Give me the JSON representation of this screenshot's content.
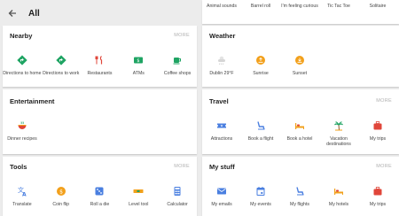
{
  "header": {
    "title": "All",
    "back_icon": "arrow-left-icon"
  },
  "colors": {
    "orange": "#f2a01b",
    "blue": "#4a7fe0",
    "green": "#1fa463",
    "red": "#e0463a",
    "gray": "#b0b0b0"
  },
  "top_row": [
    {
      "label": "Animal sounds"
    },
    {
      "label": "Barrel roll"
    },
    {
      "label": "I'm feeling curious"
    },
    {
      "label": "Tic Tac Toe"
    },
    {
      "label": "Solitaire"
    }
  ],
  "nearby": {
    "title": "Nearby",
    "more": "MORE",
    "items": [
      {
        "label": "Directions to home",
        "icon": "directions-home-icon"
      },
      {
        "label": "Directions to work",
        "icon": "directions-work-icon"
      },
      {
        "label": "Restaurants",
        "icon": "restaurant-icon"
      },
      {
        "label": "ATMs",
        "icon": "atm-icon"
      },
      {
        "label": "Coffee shops",
        "icon": "coffee-icon"
      }
    ]
  },
  "weather": {
    "title": "Weather",
    "items": [
      {
        "label": "Dublin 29°F",
        "icon": "cloud-icon"
      },
      {
        "label": "Sunrise",
        "icon": "sunrise-icon"
      },
      {
        "label": "Sunset",
        "icon": "sunset-icon"
      }
    ]
  },
  "entertainment": {
    "title": "Entertainment",
    "items": [
      {
        "label": "Dinner recipes",
        "icon": "recipe-bowl-icon"
      }
    ]
  },
  "travel": {
    "title": "Travel",
    "more": "MORE",
    "items": [
      {
        "label": "Attractions",
        "icon": "ticket-icon"
      },
      {
        "label": "Book a flight",
        "icon": "flight-seat-icon"
      },
      {
        "label": "Book a hotel",
        "icon": "hotel-bed-icon"
      },
      {
        "label": "Vacation destinations",
        "icon": "palm-tree-icon"
      },
      {
        "label": "My trips",
        "icon": "suitcase-icon"
      }
    ]
  },
  "tools": {
    "title": "Tools",
    "more": "MORE",
    "items": [
      {
        "label": "Translate",
        "icon": "translate-icon"
      },
      {
        "label": "Coin flip",
        "icon": "coin-icon"
      },
      {
        "label": "Roll a die",
        "icon": "die-icon"
      },
      {
        "label": "Level tool",
        "icon": "level-tool-icon"
      },
      {
        "label": "Calculator",
        "icon": "calculator-icon"
      }
    ]
  },
  "mystuff": {
    "title": "My stuff",
    "more": "MORE",
    "items": [
      {
        "label": "My emails",
        "icon": "email-icon"
      },
      {
        "label": "My events",
        "icon": "calendar-icon"
      },
      {
        "label": "My flights",
        "icon": "flight-seat-icon"
      },
      {
        "label": "My hotels",
        "icon": "hotel-bed-icon"
      },
      {
        "label": "My trips",
        "icon": "suitcase-icon"
      }
    ]
  }
}
